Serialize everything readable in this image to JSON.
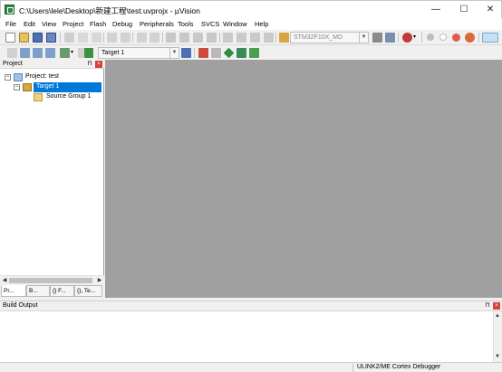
{
  "window": {
    "title": "C:\\Users\\lele\\Desktop\\新建工程\\test.uvprojx - µVision",
    "minimize": "—",
    "maximize": "☐",
    "close": "✕"
  },
  "menu": [
    "File",
    "Edit",
    "View",
    "Project",
    "Flash",
    "Debug",
    "Peripherals",
    "Tools",
    "SVCS",
    "Window",
    "Help"
  ],
  "toolbar": {
    "device_select": "STM32F10X_MD",
    "target_select": "Target 1"
  },
  "project_panel": {
    "title": "Project",
    "pin": "⊓",
    "close": "×",
    "tree": {
      "root": "Project: test",
      "target": "Target 1",
      "group": "Source Group 1"
    },
    "tabs": [
      "Pr...",
      "B...",
      "{} F...",
      "{}, Te..."
    ]
  },
  "output_panel": {
    "title": "Build Output",
    "pin": "⊓",
    "close": "×"
  },
  "status": {
    "debugger": "ULINK2/ME Cortex Debugger"
  },
  "colors": {
    "selection": "#0078d7",
    "editor_bg": "#a0a0a0",
    "close_red": "#d8423a"
  }
}
